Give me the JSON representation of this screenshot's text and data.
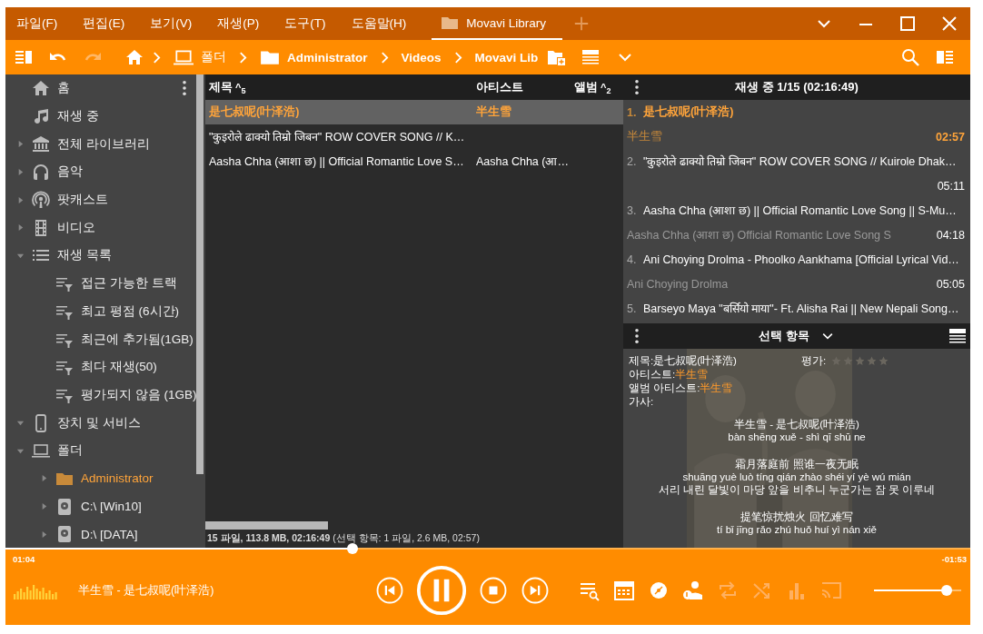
{
  "menu": [
    {
      "label": "파일(F)"
    },
    {
      "label": "편집(E)"
    },
    {
      "label": "보기(V)"
    },
    {
      "label": "재생(P)"
    },
    {
      "label": "도구(T)"
    },
    {
      "label": "도움말(H)"
    }
  ],
  "tabs": [
    {
      "label": "Movavi Library",
      "selected": true
    }
  ],
  "toolbar": {
    "undo_disabled": false,
    "redo_disabled": true,
    "breadcrumb": [
      {
        "label": "폴더",
        "kind": "computer"
      },
      {
        "label": "Administrator",
        "kind": "folder"
      },
      {
        "label": "Videos",
        "kind": "plain"
      },
      {
        "label": "Movavi Lib",
        "kind": "plain"
      }
    ]
  },
  "sidebar": {
    "items": [
      {
        "label": "홈",
        "kind": "home",
        "selected": false
      },
      {
        "label": "재생 중",
        "kind": "nowplaying",
        "selected": false
      },
      {
        "label": "전체 라이브러리",
        "kind": "library",
        "selected": false,
        "expanded": false
      },
      {
        "label": "음악",
        "kind": "music",
        "selected": false,
        "expanded": false
      },
      {
        "label": "팟캐스트",
        "kind": "podcast",
        "selected": false,
        "expanded": false
      },
      {
        "label": "비디오",
        "kind": "video",
        "selected": false,
        "expanded": false
      },
      {
        "label": "재생 목록",
        "kind": "playlist",
        "selected": false,
        "expanded": true,
        "children": [
          {
            "label": "접근 가능한 트랙",
            "kind": "filter",
            "selected": false
          },
          {
            "label": "최고 평점 (6시간)",
            "kind": "filter",
            "selected": false
          },
          {
            "label": "최근에 추가됨(1GB)",
            "kind": "filter",
            "selected": false
          },
          {
            "label": "최다 재생(50)",
            "kind": "filter",
            "selected": false
          },
          {
            "label": "평가되지 않음 (1GB)",
            "kind": "filter",
            "selected": false
          }
        ]
      },
      {
        "label": "장치 및 서비스",
        "kind": "device",
        "selected": false,
        "expanded": true
      },
      {
        "label": "폴더",
        "kind": "computer",
        "selected": false,
        "expanded": true,
        "children": [
          {
            "label": "Administrator",
            "kind": "folder",
            "selected": true,
            "expanded": false
          },
          {
            "label": "C:\\ [Win10]",
            "kind": "drive",
            "selected": false,
            "expanded": false
          },
          {
            "label": "D:\\ [DATA]",
            "kind": "drive",
            "selected": false,
            "expanded": false
          }
        ]
      }
    ]
  },
  "tracklist": {
    "columns": [
      {
        "label": "제목",
        "sort_mark": "^",
        "sort_count": "5"
      },
      {
        "label": "아티스트"
      },
      {
        "label": "앨범",
        "sort_mark": "^",
        "sort_count": "2"
      }
    ],
    "rows": [
      {
        "title": "是七叔呢(叶泽浩)",
        "artist": "半生雪",
        "selected": true
      },
      {
        "title": "\"कुइरोले ढाक्यो तिम्रो जिबन\" ROW COVER SONG // K…",
        "selected": false
      },
      {
        "title": "Aasha Chha (आशा छ) || Official Romantic Love S…",
        "artist": "Aasha Chha (आ…",
        "selected": false
      }
    ],
    "status": "**15 파일, 113.8 MB, 02:16:49** (선택 항목: 1 파일, 2.6 MB, 02:57)"
  },
  "now_playing": {
    "header": "재생 중 1/15 (02:16:49)",
    "items": [
      {
        "number": "1.",
        "title": "是七叔呢(叶泽浩)",
        "artist": "半生雪",
        "duration": "02:57",
        "current": true
      },
      {
        "number": "2.",
        "title": "\"कुइरोले ढाक्यो तिम्रो जिबन\" ROW COVER SONG // Kuirole Dhak…",
        "duration": "05:11",
        "current": false
      },
      {
        "number": "3.",
        "title": "Aasha Chha (आशा छ) || Official Romantic Love Song  || S-Mu…",
        "artist": "Aasha Chha (आशा छ) Official Romantic Love Song S",
        "duration": "04:18",
        "current": false
      },
      {
        "number": "4.",
        "title": "Ani Choying Drolma - Phoolko Aankhama [Official Lyrical Vid…",
        "artist": "Ani Choying Drolma",
        "duration": "05:05",
        "current": false
      },
      {
        "number": "5.",
        "title": "Barseyo Maya \"बर्सियो माया\"- Ft. Alisha Rai || New Nepali Song…",
        "current": false
      }
    ]
  },
  "selection": {
    "header": "선택 항목",
    "fields": [
      {
        "label": "제목:",
        "value": "是七叔呢(叶泽浩)",
        "kind": "plain"
      },
      {
        "label": "아티스트:",
        "value": "半生雪",
        "kind": "link"
      },
      {
        "label": "앨범 아티스트:",
        "value": "半生雪",
        "kind": "link"
      },
      {
        "label": "가사:"
      }
    ],
    "rating": {
      "label": "평가:",
      "stars": 0
    },
    "artwork": {
      "kind": "picture"
    },
    "lyrics": [
      [
        "半生雪 - 是七叔呢(叶泽浩)",
        "bàn shēng xuě - shì qī shū ne"
      ],
      [
        "霜月落庭前 照谁一夜无眠",
        "shuāng yuè luò tíng qián zhào shéi yí yè wú mián",
        "서리 내린 달빛이 마당 앞을 비추니 누군가는 잠 못 이루네"
      ],
      [
        "提笔惊扰烛火 回忆难写",
        "tí bǐ jīng rǎo zhú huǒ huí yì nán xiě"
      ]
    ]
  },
  "player": {
    "elapsed": "01:04",
    "remaining": "-01:53",
    "level": 0.36,
    "now_playing": "半生雪 - 是七叔呢(叶泽浩)",
    "playing": true,
    "volume": {
      "level": 0.83
    },
    "toggles": [
      {
        "kind": "repeat",
        "on": false
      },
      {
        "kind": "shuffle",
        "on": false
      },
      {
        "kind": "equalizer",
        "on": false
      },
      {
        "kind": "cast",
        "on": false
      }
    ]
  }
}
